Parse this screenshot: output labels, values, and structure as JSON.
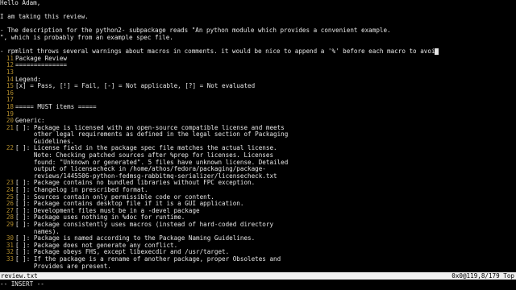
{
  "email_lines": [
    "Hello Adam,",
    "",
    "I am taking this review.",
    "",
    "- The description for the python2- subpackage reads \"An python module which provides a convenient example.",
    "\", which is probably from an example spec file.",
    "",
    "- rpmlint throws several warnings about macros in comments. it would be nice to append a '%' before each macro to avoi"
  ],
  "numbered_lines": [
    {
      "n": "11",
      "t": "Package Review"
    },
    {
      "n": "12",
      "t": "=============="
    },
    {
      "n": "13",
      "t": ""
    },
    {
      "n": "14",
      "t": "Legend:"
    },
    {
      "n": "15",
      "t": "[x] = Pass, [!] = Fail, [-] = Not applicable, [?] = Not evaluated"
    },
    {
      "n": "16",
      "t": ""
    },
    {
      "n": "17",
      "t": ""
    },
    {
      "n": "18",
      "t": "===== MUST items ====="
    },
    {
      "n": "19",
      "t": ""
    },
    {
      "n": "20",
      "t": "Generic:"
    },
    {
      "n": "21",
      "t": "[ ]: Package is licensed with an open-source compatible license and meets"
    },
    {
      "n": "",
      "t": "     other legal requirements as defined in the legal section of Packaging"
    },
    {
      "n": "",
      "t": "     Guidelines."
    },
    {
      "n": "22",
      "t": "[ ]: License field in the package spec file matches the actual license."
    },
    {
      "n": "",
      "t": "     Note: Checking patched sources after %prep for licenses. Licenses"
    },
    {
      "n": "",
      "t": "     found: \"Unknown or generated\". 5 files have unknown license. Detailed"
    },
    {
      "n": "",
      "t": "     output of licensecheck in /home/athos/fedora/packaging/package-"
    },
    {
      "n": "",
      "t": "     reviews/1445506-python-fedmsg-rabbitmq-serializer/licensecheck.txt"
    },
    {
      "n": "23",
      "t": "[ ]: Package contains no bundled libraries without FPC exception."
    },
    {
      "n": "24",
      "t": "[ ]: Changelog in prescribed format."
    },
    {
      "n": "25",
      "t": "[ ]: Sources contain only permissible code or content."
    },
    {
      "n": "26",
      "t": "[ ]: Package contains desktop file if it is a GUI application."
    },
    {
      "n": "27",
      "t": "[ ]: Development files must be in a -devel package"
    },
    {
      "n": "28",
      "t": "[ ]: Package uses nothing in %doc for runtime."
    },
    {
      "n": "29",
      "t": "[ ]: Package consistently uses macros (instead of hard-coded directory"
    },
    {
      "n": "",
      "t": "     names)."
    },
    {
      "n": "30",
      "t": "[ ]: Package is named according to the Package Naming Guidelines."
    },
    {
      "n": "31",
      "t": "[ ]: Package does not generate any conflict."
    },
    {
      "n": "32",
      "t": "[ ]: Package obeys FHS, except libexecdir and /usr/target."
    },
    {
      "n": "33",
      "t": "[ ]: If the package is a rename of another package, proper Obsoletes and"
    },
    {
      "n": "",
      "t": "     Provides are present."
    }
  ],
  "status": {
    "filename": "review.txt",
    "position": "0x0@119,8/179 Top"
  },
  "mode_text": "-- INSERT --"
}
